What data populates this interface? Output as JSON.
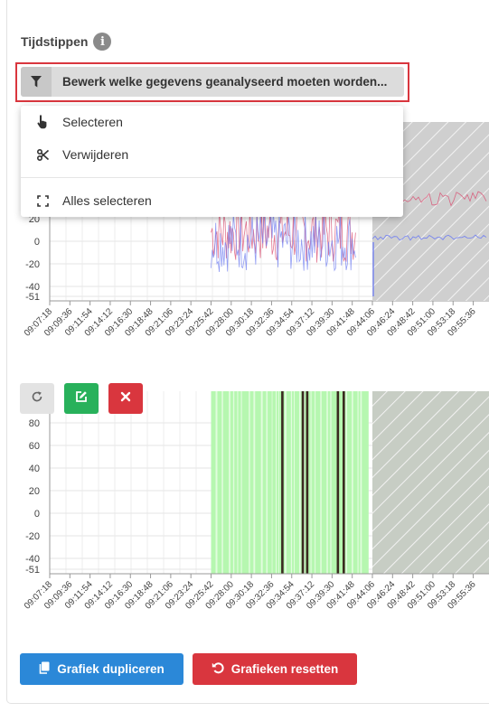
{
  "section": {
    "title": "Tijdstippen",
    "info_icon": "info-icon"
  },
  "filter": {
    "label": "Bewerk welke gegevens geanalyseerd moeten worden...",
    "icon": "filter-icon"
  },
  "menu": {
    "items": [
      {
        "label": "Selecteren",
        "icon": "pointer-hand-icon"
      },
      {
        "label": "Verwijderen",
        "icon": "scissors-icon"
      },
      {
        "label": "Alles selecteren",
        "icon": "select-all-icon"
      }
    ]
  },
  "chart_data": [
    {
      "type": "line",
      "y_ticks": [
        "20",
        "0",
        "-20",
        "-40",
        "-51"
      ],
      "x": [
        "09:07:18",
        "09:09:36",
        "09:11:54",
        "09:14:12",
        "09:16:30",
        "09:18:48",
        "09:21:06",
        "09:23:24",
        "09:25:42",
        "09:28:00",
        "09:30:18",
        "09:32:36",
        "09:34:54",
        "09:37:12",
        "09:39:30",
        "09:41:48",
        "09:44:06",
        "09:46:24",
        "09:48:42",
        "09:51:00",
        "09:53:18",
        "09:55:36"
      ],
      "ylim": [
        -51,
        20
      ],
      "series": [
        {
          "color": "#d94a6e",
          "note_range": [
            "09:25:42",
            "09:41:48"
          ]
        },
        {
          "color": "#6f7ef2",
          "note_range": [
            "09:25:42",
            "09:41:48"
          ]
        }
      ],
      "excluded_after": "09:44:06",
      "grid": true
    },
    {
      "type": "bar",
      "y_ticks": [
        "80",
        "60",
        "40",
        "20",
        "0",
        "-20",
        "-40",
        "-51"
      ],
      "x": [
        "09:07:18",
        "09:09:36",
        "09:11:54",
        "09:14:12",
        "09:16:30",
        "09:18:48",
        "09:21:06",
        "09:23:24",
        "09:25:42",
        "09:28:00",
        "09:30:18",
        "09:32:36",
        "09:34:54",
        "09:37:12",
        "09:39:30",
        "09:41:48",
        "09:44:06",
        "09:46:24",
        "09:48:42",
        "09:51:00",
        "09:53:18",
        "09:55:36"
      ],
      "ylim": [
        -51,
        100
      ],
      "selected_range": [
        "09:25:42",
        "09:43:40"
      ],
      "markers": [
        "09:33:50",
        "09:36:10",
        "09:36:40",
        "09:40:10",
        "09:40:50"
      ],
      "excluded_after": "09:44:06",
      "grid": true
    }
  ],
  "toolbar": {
    "refresh_icon": "refresh-icon",
    "edit_icon": "edit-icon",
    "delete_icon": "close-icon"
  },
  "buttons": {
    "duplicate": {
      "label": "Grafiek dupliceren",
      "icon": "copy-icon",
      "color": "#2b88d8"
    },
    "reset": {
      "label": "Grafieken resetten",
      "icon": "undo-icon",
      "color": "#d9363e"
    }
  },
  "colors": {
    "accent_red": "#d9363e",
    "success_green": "#28b15b",
    "selection_green": "#b6f7b0"
  }
}
